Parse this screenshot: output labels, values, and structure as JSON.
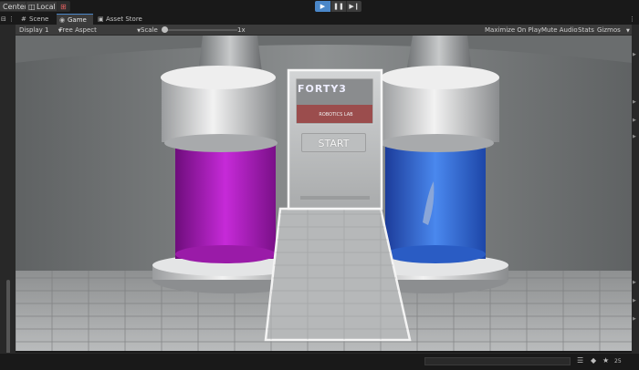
{
  "toolbar": {
    "pivot_label": "Center",
    "space_label": "Local",
    "play_icon": "play-icon",
    "pause_icon": "pause-icon",
    "step_icon": "step-icon"
  },
  "tabs": [
    {
      "label": "Scene",
      "icon": "hash-icon"
    },
    {
      "label": "Game",
      "icon": "gamepad-icon"
    },
    {
      "label": "Asset Store",
      "icon": "bag-icon"
    }
  ],
  "game_toolbar": {
    "display": "Display 1",
    "aspect": "Free Aspect",
    "scale_label": "Scale",
    "scale_value": "1x",
    "maximize": "Maximize On Play",
    "mute": "Mute Audio",
    "stats": "Stats",
    "gizmos": "Gizmos"
  },
  "game": {
    "logo_title": "FORTY3",
    "logo_subtitle": "ROBOTICS LAB",
    "start_label": "START",
    "left_tube_color": "#b21fc4",
    "right_tube_color": "#2f6ee0"
  },
  "statusbar": {
    "badge": "25"
  }
}
